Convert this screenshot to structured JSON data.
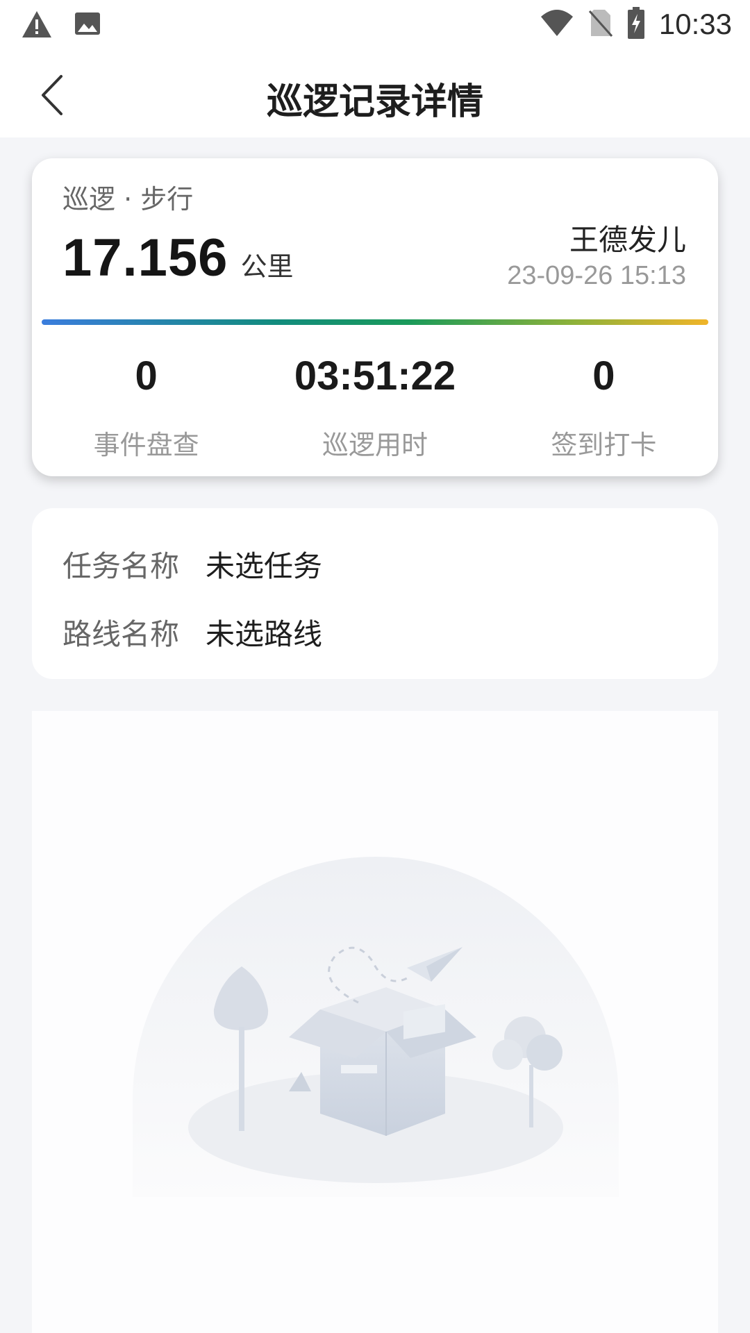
{
  "status_bar": {
    "time": "10:33",
    "icons": [
      "warning-icon",
      "image-icon",
      "wifi-icon",
      "no-sim-icon",
      "battery-charging-icon"
    ]
  },
  "header": {
    "title": "巡逻记录详情",
    "back_icon": "chevron-left-icon"
  },
  "summary": {
    "mode": "巡逻 · 步行",
    "distance_value": "17.156",
    "distance_unit": "公里",
    "user": "王德发儿",
    "datetime": "23-09-26 15:13",
    "gradient_colors": [
      "#3b7ddd",
      "#128c7e",
      "#1a9a5a",
      "#8fb23a",
      "#f0b429"
    ],
    "stats": [
      {
        "value": "0",
        "label": "事件盘查"
      },
      {
        "value": "03:51:22",
        "label": "巡逻用时"
      },
      {
        "value": "0",
        "label": "签到打卡"
      }
    ]
  },
  "info": {
    "task_key": "任务名称",
    "task_value": "未选任务",
    "route_key": "路线名称",
    "route_value": "未选路线"
  },
  "empty_state": {
    "illustration": "empty-box-illustration"
  }
}
